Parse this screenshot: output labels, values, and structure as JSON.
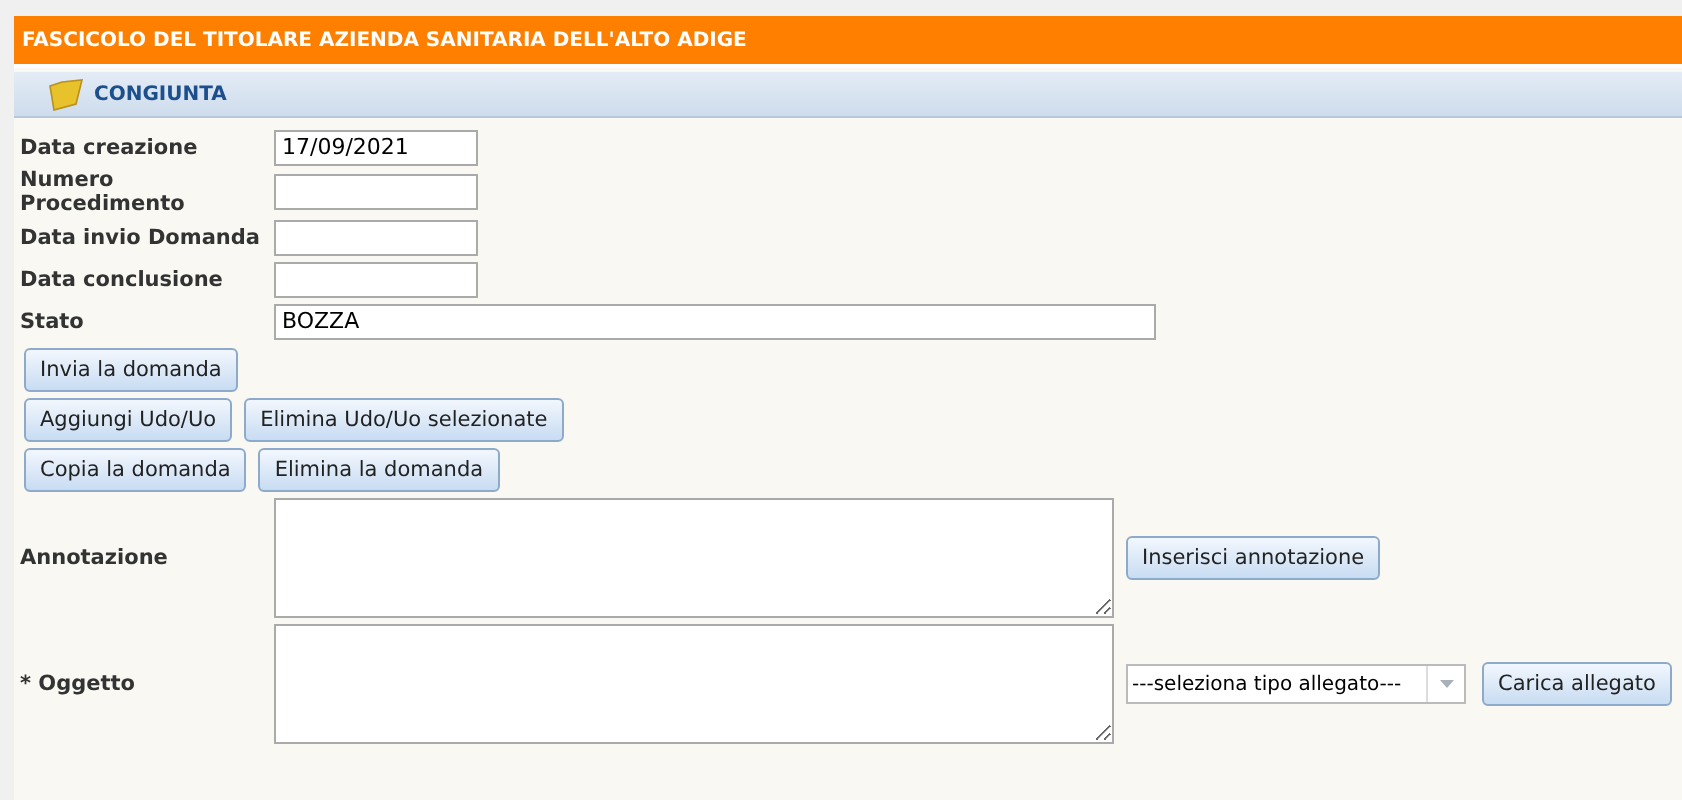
{
  "header": {
    "title": "FASCICOLO DEL TITOLARE AZIENDA SANITARIA DELL'ALTO ADIGE"
  },
  "section": {
    "title": "CONGIUNTA"
  },
  "fields": [
    {
      "label": "Data creazione",
      "value": "17/09/2021",
      "kind": "short"
    },
    {
      "label": "Numero Procedimento",
      "kind": "short"
    },
    {
      "label": "Data invio Domanda",
      "kind": "short"
    },
    {
      "label": "Data conclusione",
      "kind": "short"
    },
    {
      "label": "Stato",
      "value": "BOZZA",
      "kind": "long"
    }
  ],
  "button_rows": [
    [
      "Invia la domanda"
    ],
    [
      "Aggiungi Udo/Uo",
      "Elimina Udo/Uo selezionate"
    ],
    [
      "Copia la domanda",
      "Elimina la domanda"
    ]
  ],
  "annotation": {
    "label": "Annotazione",
    "button": "Inserisci annotazione"
  },
  "subject": {
    "label": "* Oggetto",
    "select": "---seleziona tipo allegato---",
    "button": "Carica allegato"
  }
}
